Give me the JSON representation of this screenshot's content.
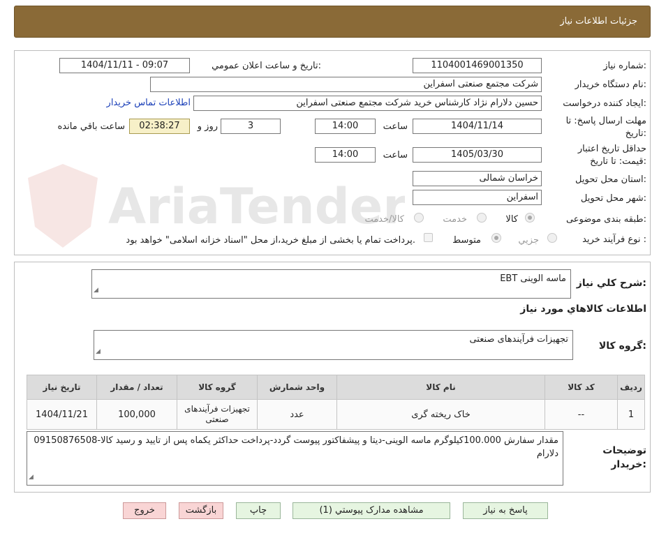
{
  "header": {
    "title": "جزئیات اطلاعات نیاز"
  },
  "watermark": {
    "text": "AriaTender.neT"
  },
  "form": {
    "need_number": {
      "label": "شماره نیاز:",
      "value": "1104001469001350"
    },
    "announce": {
      "label": "تاریخ و ساعت اعلان عمومي:",
      "value": "1404/11/11 - 09:07"
    },
    "buyer_org": {
      "label": "نام دستگاه خریدار:",
      "value": "شرکت مجتمع صنعتی اسفراین"
    },
    "requester": {
      "label": "ایجاد کننده درخواست:",
      "value": "حسین دلارام نژاد کارشناس خرید شرکت مجتمع صنعتی اسفراین",
      "contact_link": "اطلاعات تماس خریدار"
    },
    "deadline": {
      "label_line1": "مهلت ارسال پاسخ: تا",
      "label_line2": "تاریخ:",
      "date": "1404/11/14",
      "time_label": "ساعت",
      "time": "14:00",
      "days": "3",
      "days_label": "روز و",
      "remaining": "02:38:27",
      "remaining_label": "ساعت باقي مانده"
    },
    "validity": {
      "label_line1": "حداقل تاریخ اعتبار",
      "label_line2": "قیمت: تا تاریخ:",
      "date": "1405/03/30",
      "time_label": "ساعت",
      "time": "14:00"
    },
    "province": {
      "label": "استان محل تحویل:",
      "value": "خراسان شمالی"
    },
    "city": {
      "label": "شهر محل تحویل:",
      "value": "اسفراین"
    },
    "category": {
      "label": "طبقه بندی موضوعی:",
      "options": [
        "کالا",
        "خدمت",
        "کالا/خدمت"
      ],
      "selected": "کالا"
    },
    "process": {
      "label": "نوع فرآیند خرید :",
      "options": [
        "جزیي",
        "متوسط"
      ],
      "selected": "متوسط",
      "note": "پرداخت تمام یا بخشی از مبلغ خرید،از محل \"اسناد خزانه اسلامی\" خواهد بود."
    }
  },
  "summary": {
    "label": "شرح كلي نياز:",
    "value": "ماسه الوینی EBT"
  },
  "goods_info_title": "اطلاعات كالاهاي مورد نياز",
  "goods_group": {
    "label": "گروه کالا:",
    "value": "تجهیزات فرآیندهای صنعتی"
  },
  "table": {
    "headers": [
      "رديف",
      "کد کالا",
      "نام کالا",
      "واحد شمارش",
      "گروه کالا",
      "تعداد / مقدار",
      "تاريخ نياز"
    ],
    "rows": [
      [
        "1",
        "--",
        "خاک ریخته گری",
        "عدد",
        "تجهیزات فرآیندهای صنعتی",
        "100,000",
        "1404/11/21"
      ]
    ]
  },
  "buyer_notes": {
    "label_line1": "توضیحات",
    "label_line2": "خریدار:",
    "value": "مقدار سفارش 100.000کیلوگرم ماسه الوینی-دیتا و پیشفاکتور پیوست گردد-پرداخت حداکثر یکماه پس از تایید و رسید کالا-09150876508 دلارام"
  },
  "buttons": {
    "respond": "پاسخ به نياز",
    "attachments": "مشاهده مدارک پیوستي (1)",
    "print": "چاپ",
    "back": "بازگشت",
    "exit": "خروج"
  }
}
